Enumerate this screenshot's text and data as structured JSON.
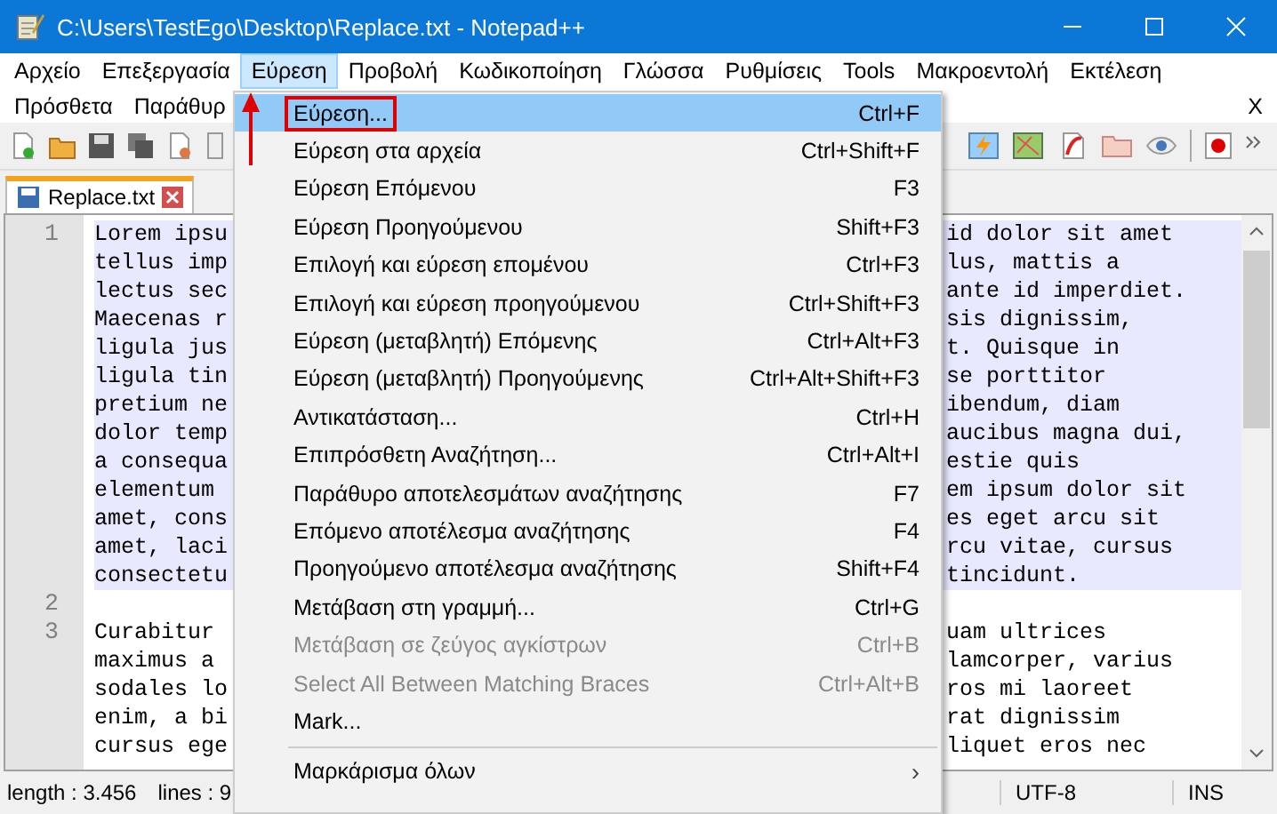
{
  "window": {
    "title": "C:\\Users\\TestEgo\\Desktop\\Replace.txt - Notepad++"
  },
  "menubar": [
    {
      "label": "Αρχείο",
      "selected": false
    },
    {
      "label": "Επεξεργασία",
      "selected": false
    },
    {
      "label": "Εύρεση",
      "selected": true
    },
    {
      "label": "Προβολή",
      "selected": false
    },
    {
      "label": "Κωδικοποίηση",
      "selected": false
    },
    {
      "label": "Γλώσσα",
      "selected": false
    },
    {
      "label": "Ρυθμίσεις",
      "selected": false
    },
    {
      "label": "Tools",
      "selected": false
    },
    {
      "label": "Μακροεντολή",
      "selected": false
    },
    {
      "label": "Εκτέλεση",
      "selected": false
    }
  ],
  "menubar_row2": [
    "Πρόσθετα",
    "Παράθυρ"
  ],
  "close_document": "X",
  "tab": {
    "label": "Replace.txt",
    "selected": true
  },
  "editor": {
    "lines": [
      {
        "number": "1",
        "selected": true,
        "rows": [
          [
            "Lorem ipsu",
            "id dolor sit amet"
          ],
          [
            "tellus imp",
            "lus, mattis a"
          ],
          [
            "lectus sec",
            "ante id imperdiet."
          ],
          [
            "Maecenas r",
            "sis dignissim,"
          ],
          [
            "ligula jus",
            "t. Quisque in"
          ],
          [
            "ligula tin",
            "se porttitor"
          ],
          [
            "pretium ne",
            "ibendum, diam"
          ],
          [
            "dolor temp",
            "aucibus magna dui,"
          ],
          [
            "a consequa",
            "estie quis"
          ],
          [
            "elementum",
            "em ipsum dolor sit"
          ],
          [
            "amet, cons",
            "es eget arcu sit"
          ],
          [
            "amet, laci",
            "rcu vitae, cursus"
          ],
          [
            "consectetu",
            "tincidunt."
          ]
        ]
      },
      {
        "number": "2",
        "selected": false,
        "rows": [
          [
            "",
            ""
          ]
        ]
      },
      {
        "number": "3",
        "selected": false,
        "rows": [
          [
            "Curabitur",
            "uam ultrices"
          ],
          [
            "maximus a",
            "lamcorper, varius"
          ],
          [
            "sodales lo",
            "ros mi laoreet"
          ],
          [
            "enim, a bi",
            "rat dignissim"
          ],
          [
            "cursus ege",
            "liquet eros nec"
          ]
        ]
      }
    ]
  },
  "status_bar": {
    "length": "length : 3.456",
    "lines": "lines : 9",
    "encoding": "UTF-8",
    "mode": "INS"
  },
  "menu": {
    "items": [
      {
        "label": "Εύρεση...",
        "shortcut": "Ctrl+F",
        "selected": true,
        "disabled": false,
        "annotated": true
      },
      {
        "label": "Εύρεση στα αρχεία",
        "shortcut": "Ctrl+Shift+F",
        "selected": false,
        "disabled": false,
        "annotated": false
      },
      {
        "label": "Εύρεση Επόμενου",
        "shortcut": "F3",
        "selected": false,
        "disabled": false,
        "annotated": false
      },
      {
        "label": "Εύρεση Προηγούμενου",
        "shortcut": "Shift+F3",
        "selected": false,
        "disabled": false,
        "annotated": false
      },
      {
        "label": "Επιλογή και εύρεση επομένου",
        "shortcut": "Ctrl+F3",
        "selected": false,
        "disabled": false,
        "annotated": false
      },
      {
        "label": "Επιλογή και εύρεση προηγούμενου",
        "shortcut": "Ctrl+Shift+F3",
        "selected": false,
        "disabled": false,
        "annotated": false
      },
      {
        "label": "Εύρεση (μεταβλητή) Επόμενης",
        "shortcut": "Ctrl+Alt+F3",
        "selected": false,
        "disabled": false,
        "annotated": false
      },
      {
        "label": "Εύρεση (μεταβλητή) Προηγούμενης",
        "shortcut": "Ctrl+Alt+Shift+F3",
        "selected": false,
        "disabled": false,
        "annotated": false
      },
      {
        "label": "Αντικατάσταση...",
        "shortcut": "Ctrl+H",
        "selected": false,
        "disabled": false,
        "annotated": false
      },
      {
        "label": "Επιπρόσθετη Αναζήτηση...",
        "shortcut": "Ctrl+Alt+I",
        "selected": false,
        "disabled": false,
        "annotated": false
      },
      {
        "label": "Παράθυρο αποτελεσμάτων αναζήτησης",
        "shortcut": "F7",
        "selected": false,
        "disabled": false,
        "annotated": false
      },
      {
        "label": "Επόμενο αποτέλεσμα αναζήτησης",
        "shortcut": "F4",
        "selected": false,
        "disabled": false,
        "annotated": false
      },
      {
        "label": "Προηγούμενο αποτέλεσμα αναζήτησης",
        "shortcut": "Shift+F4",
        "selected": false,
        "disabled": false,
        "annotated": false
      },
      {
        "label": "Μετάβαση στη γραμμή...",
        "shortcut": "Ctrl+G",
        "selected": false,
        "disabled": false,
        "annotated": false
      },
      {
        "label": "Μετάβαση σε ζεύγος αγκίστρων",
        "shortcut": "Ctrl+B",
        "selected": false,
        "disabled": true,
        "annotated": false
      },
      {
        "label": "Select All Between Matching Braces",
        "shortcut": "Ctrl+Alt+B",
        "selected": false,
        "disabled": true,
        "annotated": false
      },
      {
        "label": "Mark...",
        "selected": false,
        "disabled": false,
        "annotated": false
      },
      {
        "label": "Μαρκάρισμα όλων",
        "selected": false,
        "disabled": false,
        "annotated": false,
        "separator_before": true,
        "submenu": "›"
      }
    ]
  }
}
